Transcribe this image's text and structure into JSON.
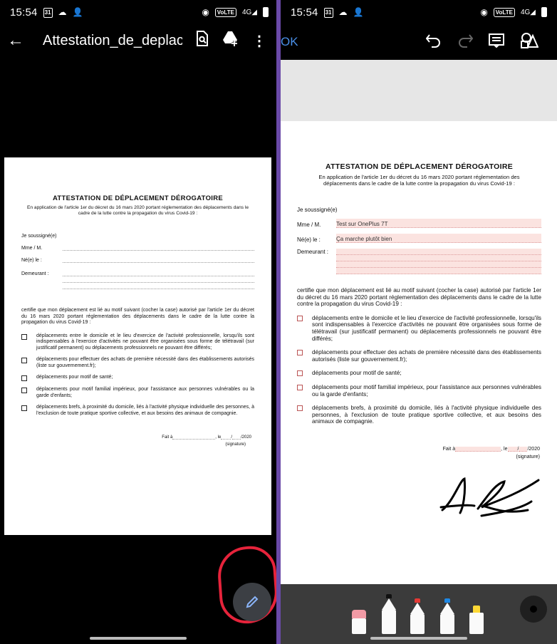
{
  "status_bar": {
    "time": "15:54",
    "calendar_day": "31",
    "network_badge": "VoLTE",
    "network_gen": "4G"
  },
  "left_app": {
    "toolbar": {
      "title": "Attestation_de_deplac...",
      "icons": [
        "back-arrow-icon",
        "document-search-icon",
        "drive-add-icon",
        "more-vert-icon"
      ]
    },
    "fab_icon": "pencil-icon",
    "highlight_color": "#e6233b"
  },
  "right_app": {
    "toolbar": {
      "ok_label": "OK",
      "ok_color": "#4a8fe8",
      "icons": [
        "undo-icon",
        "redo-icon",
        "notes-icon",
        "shapes-icon"
      ]
    },
    "pen_tray": [
      "eraser-pink",
      "pen-black",
      "pen-red",
      "pen-blue",
      "highlighter-yellow"
    ],
    "filled": {
      "name": "Test sur OnePlus 7T",
      "birth": "Ça marche plutôt bien"
    }
  },
  "document": {
    "title": "ATTESTATION DE DÉPLACEMENT DÉROGATOIRE",
    "subtitle": "En application de l'article 1er du décret du 16 mars 2020 portant réglementation des déplacements dans le cadre de la lutte contre la propagation du virus Covid-19 :",
    "je_soussigne": "Je soussigné(e)",
    "mme_m": "Mme / M.",
    "ne_le": "Né(e) le :",
    "demeurant": "Demeurant :",
    "certifie": "certifie que mon déplacement est lié au motif suivant (cocher la case) autorisé par l'article 1er du décret du 16 mars 2020 portant réglementation des déplacements dans le cadre de la lutte contre la propagation du virus Covid-19 :",
    "options": [
      "déplacements entre le domicile et le lieu d'exercice de l'activité professionnelle, lorsqu'ils sont indispensables à l'exercice d'activités ne pouvant être organisées sous forme de télétravail (sur justificatif permanent) ou déplacements professionnels ne pouvant être différés;",
      "déplacements pour effectuer des achats de première nécessité dans des établissements autorisés (liste sur gouvernement.fr);",
      "déplacements pour motif de santé;",
      "déplacements pour motif familial impérieux, pour l'assistance aux personnes vulnérables ou la garde d'enfants;",
      "déplacements brefs, à proximité du domicile, liés à l'activité physique individuelle des personnes, à l'exclusion de toute pratique sportive collective, et aux besoins des animaux de compagnie."
    ],
    "fait_a": "Fait à",
    "le": ", le",
    "year": "/2020",
    "signature": "(signature)"
  }
}
